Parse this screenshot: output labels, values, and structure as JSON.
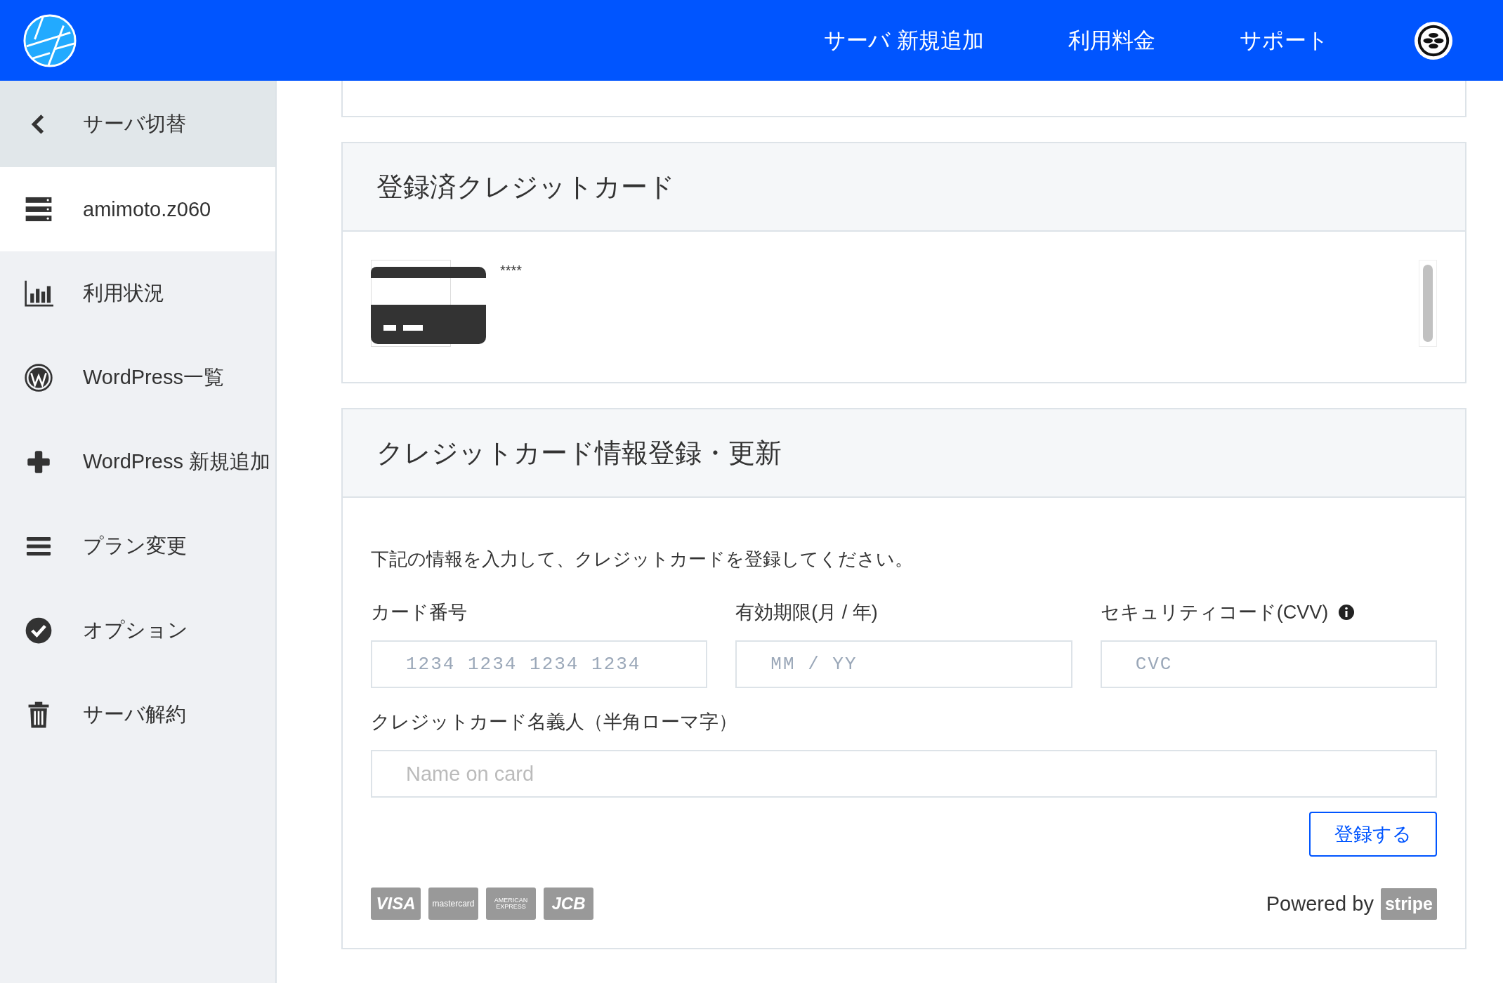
{
  "header": {
    "nav": [
      "サーバ 新規追加",
      "利用料金",
      "サポート"
    ]
  },
  "sidebar": {
    "back": {
      "label": "サーバ切替"
    },
    "items": [
      {
        "label": "amimoto.z060",
        "selected": true
      },
      {
        "label": "利用状況",
        "selected": false
      },
      {
        "label": "WordPress一覧",
        "selected": false
      },
      {
        "label": "WordPress 新規追加",
        "selected": false
      },
      {
        "label": "プラン変更",
        "selected": false
      },
      {
        "label": "オプション",
        "selected": false
      },
      {
        "label": "サーバ解約",
        "selected": false
      }
    ]
  },
  "registered_cards": {
    "title": "登録済クレジットカード",
    "cards": [
      {
        "number": "****"
      }
    ]
  },
  "card_form": {
    "title": "クレジットカード情報登録・更新",
    "description": "下記の情報を入力して、クレジットカードを登録してください。",
    "fields": [
      {
        "label": "カード番号",
        "placeholder": "1234 1234 1234 1234",
        "info": false
      },
      {
        "label": "有効期限(月 / 年)",
        "placeholder": "MM / YY",
        "info": false
      },
      {
        "label": "セキュリティコード(CVV)",
        "placeholder": "CVC",
        "info": true
      }
    ],
    "name_field": {
      "label": "クレジットカード名義人（半角ローマ字）",
      "placeholder": "Name on card"
    },
    "submit": "登録する",
    "brands": [
      "VISA",
      "mastercard",
      "AMERICAN EXPRESS",
      "JCB"
    ],
    "powered_by": "Powered by",
    "stripe": "stripe"
  }
}
